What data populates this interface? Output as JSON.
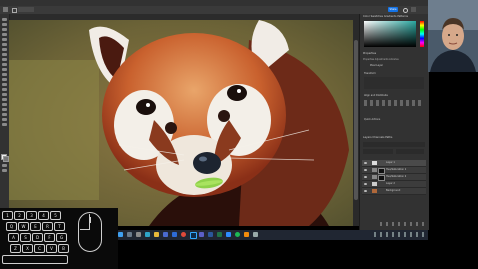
{
  "app": {
    "menu": [
      "File",
      "Edit",
      "Image",
      "Layer",
      "Type",
      "Select",
      "Filter",
      "3D",
      "View",
      "Plugins",
      "Window",
      "Help"
    ],
    "share_label": "Share",
    "tabs": [
      "panda-901474...",
      "Untitled-1 @ 100% (Layer 1, RGB/8#)"
    ]
  },
  "panels": {
    "color_tabs": [
      "Color",
      "Swatches",
      "Gradients",
      "Patterns"
    ],
    "properties_title": "Properties",
    "properties_tabs": [
      "Properties",
      "Adjustments",
      "Libraries"
    ],
    "layer_label": "Pixel Layer",
    "transform_label": "Transform",
    "align_label": "Align and Distribute",
    "quick_actions_label": "Quick Actions",
    "layers_tabs": [
      "Layers",
      "Channels",
      "Paths"
    ],
    "layers": [
      {
        "name": "Layer 1"
      },
      {
        "name": "Hue/Saturation 1"
      },
      {
        "name": "Hue/Saturation 2"
      },
      {
        "name": "Layer 2"
      },
      {
        "name": "Background"
      }
    ]
  },
  "taskbar": {
    "icons": [
      "start-icon",
      "search-icon",
      "task-view-icon",
      "edge-icon",
      "explorer-icon",
      "store-icon",
      "mail-icon",
      "chrome-icon",
      "photoshop-icon",
      "teams-icon",
      "word-icon",
      "excel-icon",
      "zoom-icon",
      "spotify-icon",
      "vlc-icon",
      "settings-icon"
    ]
  },
  "keypad": {
    "rows": [
      [
        "1",
        "2",
        "3",
        "4",
        "5"
      ],
      [
        "Q",
        "W",
        "E",
        "R",
        "T"
      ],
      [
        "A",
        "S",
        "D",
        "F",
        "G"
      ],
      [
        "Z",
        "X",
        "C",
        "V",
        "B"
      ]
    ]
  },
  "colors": {
    "accent": "#1473e6",
    "ps_dark": "#323232",
    "taskbar": "#202632"
  }
}
